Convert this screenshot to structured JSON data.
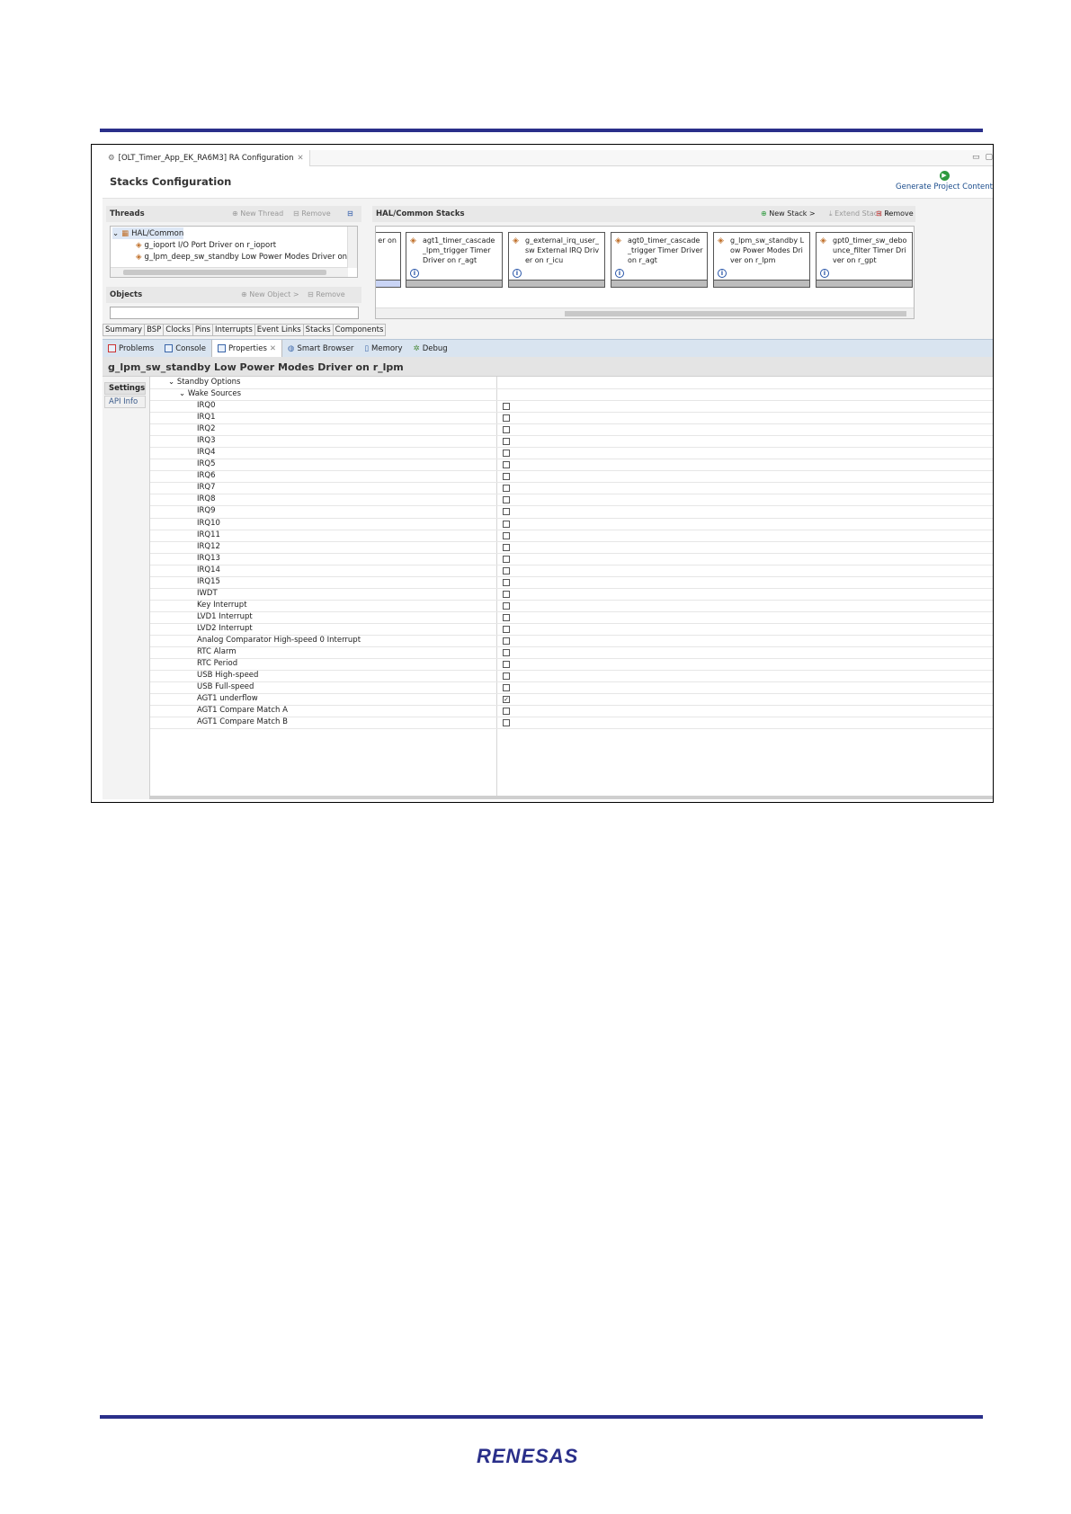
{
  "editor": {
    "tab_title": "[OLT_Timer_App_EK_RA6M3] RA Configuration",
    "page_title": "Stacks Configuration",
    "generate_label": "Generate Project Content"
  },
  "threads": {
    "header": "Threads",
    "new_thread": "New Thread",
    "remove": "Remove",
    "tree": [
      {
        "label": "HAL/Common",
        "level": 0
      },
      {
        "label": "g_ioport I/O Port Driver on r_ioport",
        "level": 1
      },
      {
        "label": "g_lpm_deep_sw_standby Low Power Modes Driver on r_lp",
        "level": 1
      }
    ]
  },
  "objects": {
    "header": "Objects",
    "new_object": "New Object >",
    "remove": "Remove"
  },
  "hal_stacks": {
    "header": "HAL/Common Stacks",
    "new_stack": "New Stack >",
    "extend_stack": "Extend Stack >",
    "remove": "Remove",
    "partial_card": "er on",
    "cards": [
      "agt1_timer_cascade_lpm_trigger Timer Driver on r_agt",
      "g_external_irq_user_sw External IRQ Driver on r_icu",
      "agt0_timer_cascade_trigger Timer Driver on r_agt",
      "g_lpm_sw_standby Low Power Modes Driver on r_lpm",
      "gpt0_timer_sw_debounce_filter Timer Driver on r_gpt"
    ]
  },
  "config_tabs": [
    "Summary",
    "BSP",
    "Clocks",
    "Pins",
    "Interrupts",
    "Event Links",
    "Stacks",
    "Components"
  ],
  "view_tabs": [
    "Problems",
    "Console",
    "Properties",
    "Smart Browser",
    "Memory",
    "Debug"
  ],
  "properties": {
    "title": "g_lpm_sw_standby Low Power Modes Driver on r_lpm",
    "side_tabs": [
      "Settings",
      "API Info"
    ],
    "groups": [
      "Standby Options",
      "Wake Sources"
    ],
    "wake_sources": [
      {
        "name": "IRQ0",
        "checked": false
      },
      {
        "name": "IRQ1",
        "checked": false
      },
      {
        "name": "IRQ2",
        "checked": false
      },
      {
        "name": "IRQ3",
        "checked": false
      },
      {
        "name": "IRQ4",
        "checked": false
      },
      {
        "name": "IRQ5",
        "checked": false
      },
      {
        "name": "IRQ6",
        "checked": false
      },
      {
        "name": "IRQ7",
        "checked": false
      },
      {
        "name": "IRQ8",
        "checked": false
      },
      {
        "name": "IRQ9",
        "checked": false
      },
      {
        "name": "IRQ10",
        "checked": false
      },
      {
        "name": "IRQ11",
        "checked": false
      },
      {
        "name": "IRQ12",
        "checked": false
      },
      {
        "name": "IRQ13",
        "checked": false
      },
      {
        "name": "IRQ14",
        "checked": false
      },
      {
        "name": "IRQ15",
        "checked": false
      },
      {
        "name": "IWDT",
        "checked": false
      },
      {
        "name": "Key Interrupt",
        "checked": false
      },
      {
        "name": "LVD1 Interrupt",
        "checked": false
      },
      {
        "name": "LVD2 Interrupt",
        "checked": false
      },
      {
        "name": "Analog Comparator High-speed 0 Interrupt",
        "checked": false
      },
      {
        "name": "RTC Alarm",
        "checked": false
      },
      {
        "name": "RTC Period",
        "checked": false
      },
      {
        "name": "USB High-speed",
        "checked": false
      },
      {
        "name": "USB Full-speed",
        "checked": false
      },
      {
        "name": "AGT1 underflow",
        "checked": true
      },
      {
        "name": "AGT1 Compare Match A",
        "checked": false
      },
      {
        "name": "AGT1 Compare Match B",
        "checked": false
      }
    ]
  },
  "footer": {
    "logo_text": "RENESAS",
    "rule_color": "#2a2f8a"
  }
}
